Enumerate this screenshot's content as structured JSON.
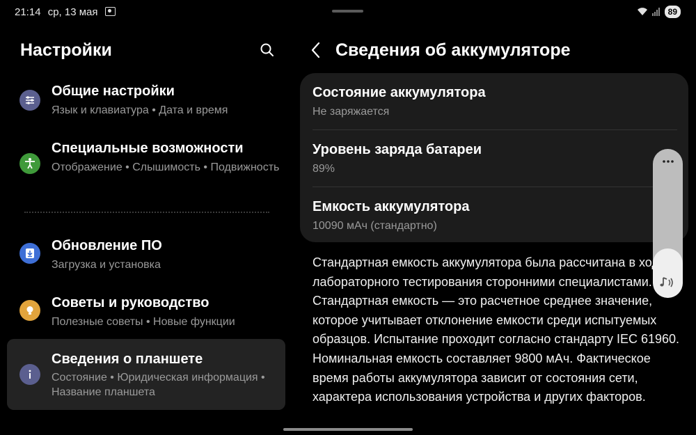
{
  "status_bar": {
    "time": "21:14",
    "date": "ср, 13 мая",
    "battery_level": "89"
  },
  "left": {
    "title": "Настройки",
    "items": [
      {
        "title": "Общие настройки",
        "subtitle": "Язык и клавиатура  •  Дата и время",
        "icon": "sliders-icon",
        "icon_color": "#5b5f8f"
      },
      {
        "title": "Специальные возможности",
        "subtitle": "Отображение  •  Слышимость  •  Подвижность",
        "icon": "accessibility-icon",
        "icon_color": "#3f9a3a"
      },
      {
        "title": "Обновление ПО",
        "subtitle": "Загрузка и установка",
        "icon": "software-update-icon",
        "icon_color": "#3e6fd6"
      },
      {
        "title": "Советы и руководство",
        "subtitle": "Полезные советы  •  Новые функции",
        "icon": "lightbulb-icon",
        "icon_color": "#e2a43c"
      },
      {
        "title": "Сведения о планшете",
        "subtitle": "Состояние  •  Юридическая информация  •  Название планшета",
        "icon": "info-icon",
        "icon_color": "#5b5f8f"
      }
    ]
  },
  "right": {
    "title": "Сведения об аккумуляторе",
    "rows": [
      {
        "title": "Состояние аккумулятора",
        "value": "Не заряжается"
      },
      {
        "title": "Уровень заряда батареи",
        "value": "89%"
      },
      {
        "title": "Емкость аккумулятора",
        "value": "10090 мАч (стандартно)"
      }
    ],
    "description": "Стандартная емкость аккумулятора была рассчитана в ходе лабораторного тестирования сторонними специалистами. Стандартная емкость — это расчетное среднее значение, которое учитывает отклонение емкости среди испытуемых образцов. Испытание проходит согласно стандарту IEC 61960. Номинальная емкость составляет 9800 мАч. Фактическое время работы аккумулятора зависит от состояния сети, характера использования устройства и других факторов."
  },
  "volume_panel": {
    "level": 0.33
  }
}
